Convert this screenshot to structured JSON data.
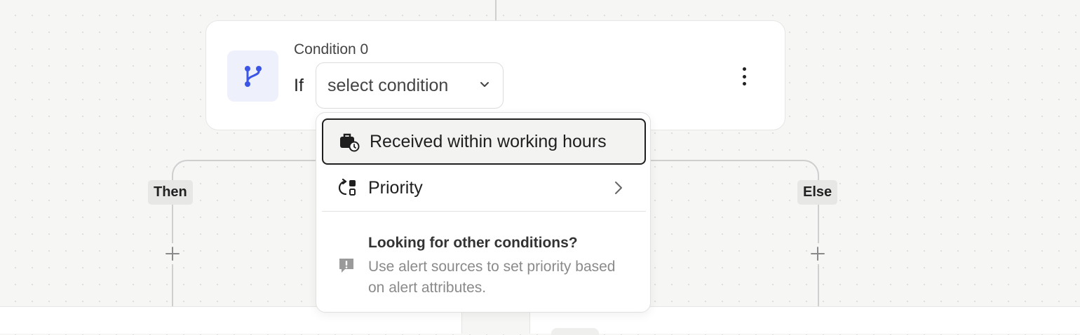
{
  "card": {
    "title": "Condition 0",
    "if_label": "If",
    "select_placeholder": "select condition",
    "icon": "branch-icon",
    "accent_color": "#3b55e6"
  },
  "branches": {
    "then_label": "Then",
    "else_label": "Else"
  },
  "dropdown": {
    "options": [
      {
        "label": "Received within working hours",
        "icon": "briefcase-clock-icon",
        "selected": true
      },
      {
        "label": "Priority",
        "icon": "priority-icon",
        "has_submenu": true
      }
    ],
    "hint_title": "Looking for other conditions?",
    "hint_body": "Use alert sources to set priority based on alert attributes.",
    "hint_icon": "alert-message-icon"
  }
}
